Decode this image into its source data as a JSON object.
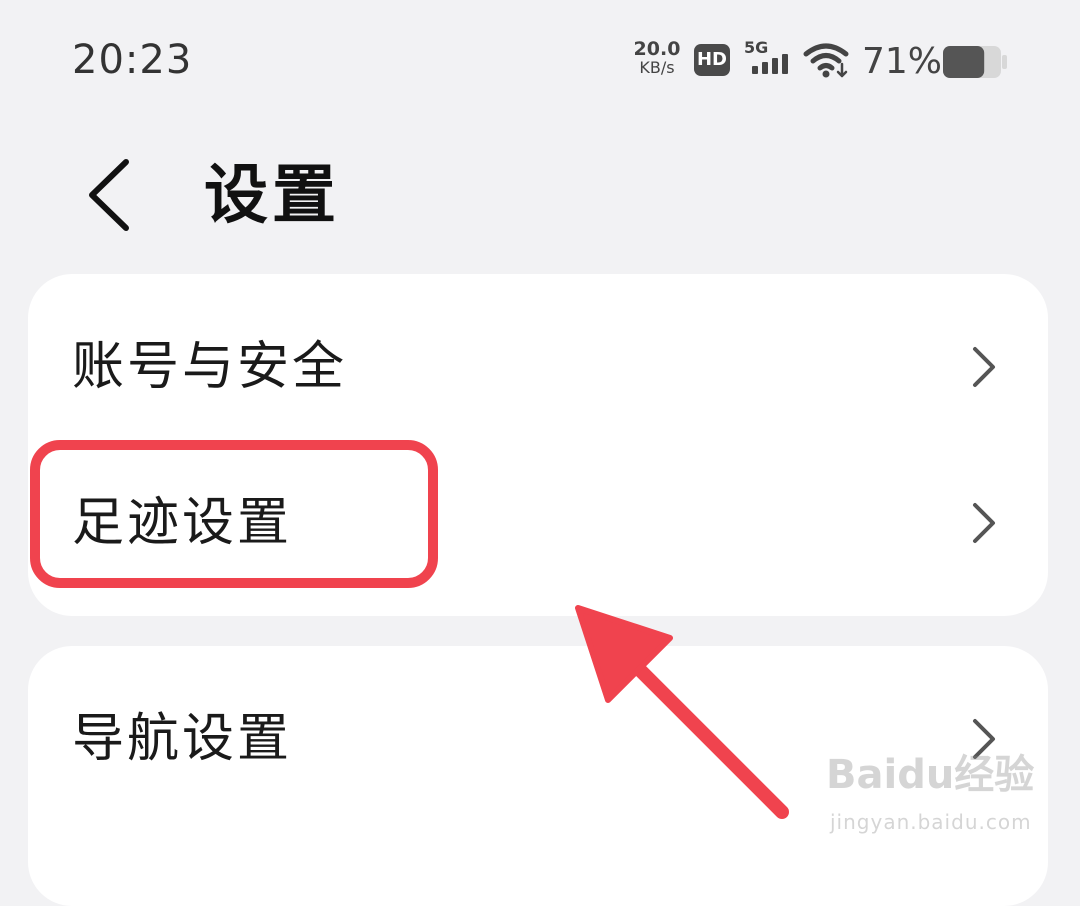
{
  "status_bar": {
    "time": "20:23",
    "net_speed_value": "20.0",
    "net_speed_unit": "KB/s",
    "hd_label": "HD",
    "network_type": "5G",
    "battery_percent": "71%",
    "battery_level": 0.71
  },
  "header": {
    "title": "设置"
  },
  "settings": {
    "group1": [
      {
        "label": "账号与安全"
      },
      {
        "label": "足迹设置"
      }
    ],
    "group2": [
      {
        "label": "导航设置"
      }
    ]
  },
  "annotation": {
    "highlight_color": "#f0434e"
  },
  "watermark": {
    "main": "Baidu经验",
    "sub": "jingyan.baidu.com"
  },
  "colors": {
    "background": "#f2f2f4",
    "card": "#ffffff",
    "text": "#1a1a1a",
    "chevron": "#555555"
  }
}
